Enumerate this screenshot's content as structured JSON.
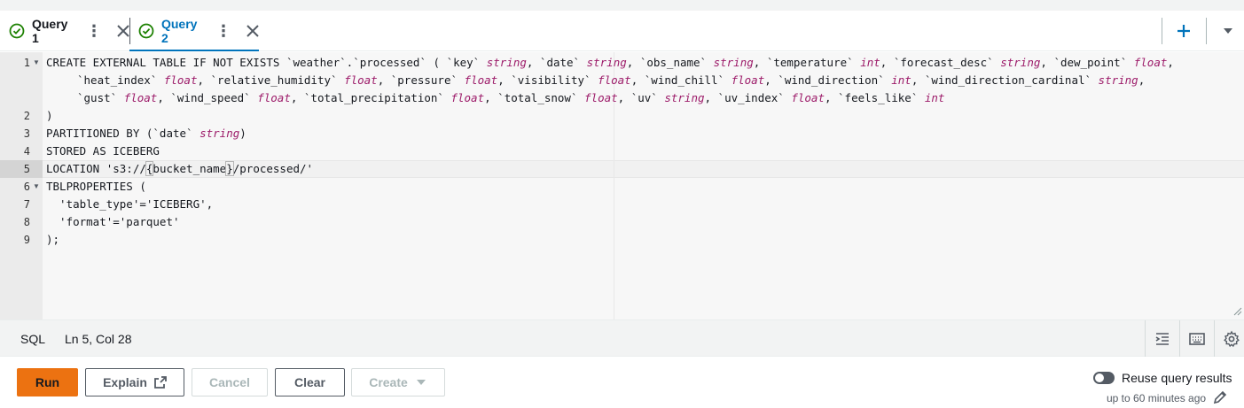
{
  "tabs": [
    {
      "label": "Query 1",
      "status_icon": "check-circle-icon",
      "active": false
    },
    {
      "label": "Query 2",
      "status_icon": "check-circle-icon",
      "active": true
    }
  ],
  "tabbar": {
    "add_icon": "plus-icon",
    "menu_icon": "caret-down-icon"
  },
  "editor": {
    "line_numbers": [
      "1",
      "2",
      "3",
      "4",
      "5",
      "6",
      "7",
      "8",
      "9"
    ],
    "active_line": "5",
    "lines": {
      "l1a_kw": "CREATE EXTERNAL TABLE IF NOT EXISTS ",
      "l1a_name": "`weather`.`processed` ( ",
      "l1a_c1": "`key` ",
      "l1a_t1": "string",
      "l1a_c2": ", `date` ",
      "l1a_t2": "string",
      "l1a_c3": ", `obs_name` ",
      "l1a_t3": "string",
      "l1a_c4": ", `temperature` ",
      "l1a_t4": "int",
      "l1a_c5": ", `forecast_desc` ",
      "l1a_t5": "string",
      "l1a_c6": ", `dew_point` ",
      "l1a_t6": "float",
      "l1a_end": ",",
      "l1b_c1": "`heat_index` ",
      "l1b_t1": "float",
      "l1b_c2": ", `relative_humidity` ",
      "l1b_t2": "float",
      "l1b_c3": ", `pressure` ",
      "l1b_t3": "float",
      "l1b_c4": ", `visibility` ",
      "l1b_t4": "float",
      "l1b_c5": ", `wind_chill` ",
      "l1b_t5": "float",
      "l1b_c6": ", `wind_direction` ",
      "l1b_t6": "int",
      "l1b_c7": ", `wind_direction_cardinal` ",
      "l1b_t7": "string",
      "l1b_end": ",",
      "l1c_c1": "`gust` ",
      "l1c_t1": "float",
      "l1c_c2": ", `wind_speed` ",
      "l1c_t2": "float",
      "l1c_c3": ", `total_precipitation` ",
      "l1c_t3": "float",
      "l1c_c4": ", `total_snow` ",
      "l1c_t4": "float",
      "l1c_c5": ", `uv` ",
      "l1c_t5": "string",
      "l1c_c6": ", `uv_index` ",
      "l1c_t6": "float",
      "l1c_c7": ", `feels_like` ",
      "l1c_t7": "int",
      "l2": ")",
      "l3a": "PARTITIONED BY (`date` ",
      "l3_t": "string",
      "l3b": ")",
      "l4": "STORED AS ICEBERG",
      "l5a": "LOCATION 's3://",
      "l5_open": "{",
      "l5_mid": "bucket_name",
      "l5_close": "}",
      "l5b": "/processed/'",
      "l6": "TBLPROPERTIES (",
      "l7": "  'table_type'='ICEBERG',",
      "l8": "  'format'='parquet'",
      "l9": ");"
    }
  },
  "status": {
    "language": "SQL",
    "position": "Ln 5, Col 28",
    "icons": [
      "indent-icon",
      "keyboard-icon",
      "settings-icon"
    ]
  },
  "actions": {
    "run": "Run",
    "explain": "Explain",
    "cancel": "Cancel",
    "clear": "Clear",
    "create": "Create",
    "reuse_label": "Reuse query results",
    "reuse_sub": "up to 60 minutes ago",
    "reuse_enabled": false
  },
  "colors": {
    "accent": "#0073bb",
    "run_button": "#ec7211",
    "success": "#1d8102",
    "type_keyword": "#9d1c6a"
  }
}
